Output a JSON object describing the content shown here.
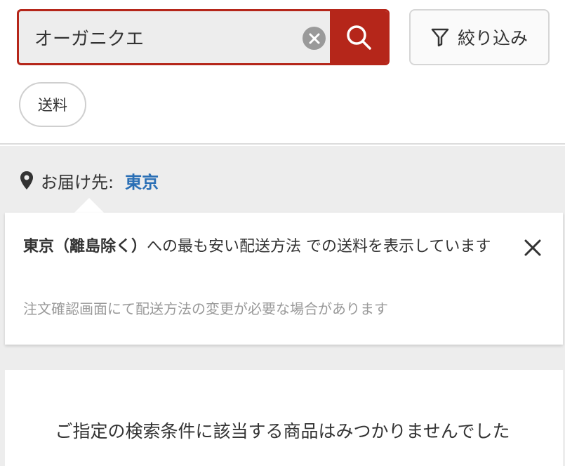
{
  "search": {
    "value": "オーガニクエ",
    "placeholder": ""
  },
  "filter": {
    "label": "絞り込み"
  },
  "chips": [
    {
      "label": "送料"
    }
  ],
  "delivery": {
    "label": "お届け先:",
    "city": "東京"
  },
  "popover": {
    "region": "東京（離島除く）",
    "message": "への最も安い配送方法 での送料を表示しています",
    "note": "注文確認画面にて配送方法の変更が必要な場合があります"
  },
  "results": {
    "empty_message": "ご指定の検索条件に該当する商品はみつかりませんでした"
  },
  "colors": {
    "accent": "#b5261a",
    "link": "#2a6fb5"
  },
  "icons": {
    "clear": "clear-circle-icon",
    "search": "search-icon",
    "filter": "filter-funnel-icon",
    "location": "location-pin-icon",
    "close": "close-icon"
  }
}
